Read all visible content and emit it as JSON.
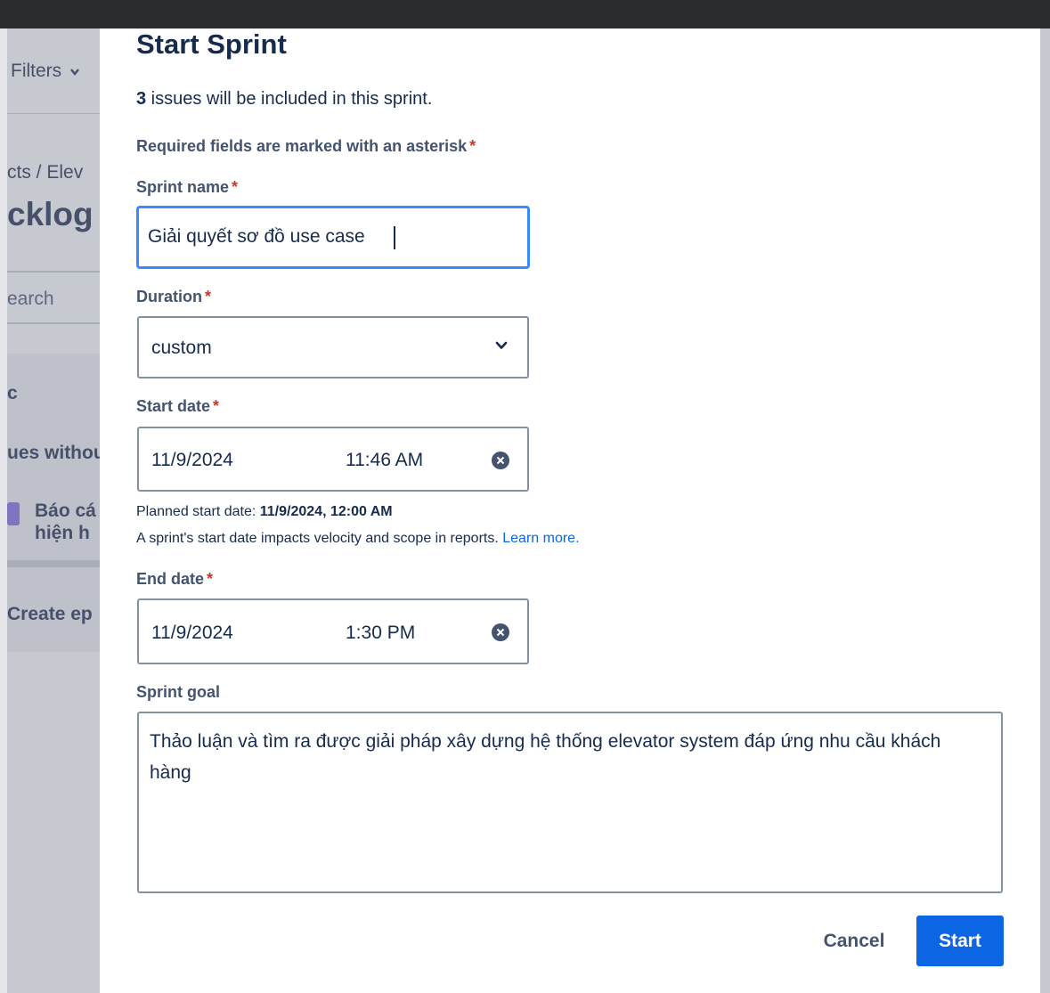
{
  "background": {
    "filters": "Filters",
    "breadcrumb": "cts  /  Elev",
    "page_title": "cklog",
    "search": "earch",
    "epic_header": "c",
    "issues_without": "ues withou",
    "epic_item_line1": "Báo cá",
    "epic_item_line2": "hiện h",
    "create_epic": "Create ep"
  },
  "modal": {
    "title": "Start Sprint",
    "issue_count": "3",
    "issue_text": " issues will be included in this sprint.",
    "required_note": "Required fields are marked with an asterisk",
    "asterisk": "*",
    "sprint_name": {
      "label": "Sprint name",
      "value": "Giải quyết sơ đồ use case"
    },
    "duration": {
      "label": "Duration",
      "value": "custom"
    },
    "start_date": {
      "label": "Start date",
      "date": "11/9/2024",
      "time": "11:46 AM",
      "planned_prefix": "Planned start date: ",
      "planned_value": "11/9/2024, 12:00 AM",
      "impact_text": "A sprint's start date impacts velocity and scope in reports. ",
      "learn_more": "Learn more."
    },
    "end_date": {
      "label": "End date",
      "date": "11/9/2024",
      "time": "1:30 PM"
    },
    "sprint_goal": {
      "label": "Sprint goal",
      "value": "Thảo luận và tìm ra được giải pháp xây dựng hệ thống elevator system đáp ứng nhu cầu khách hàng"
    },
    "cancel_label": "Cancel",
    "start_label": "Start"
  },
  "colors": {
    "primary": "#0c66e4",
    "required": "#c9372c",
    "focus": "#388bff",
    "text": "#172b4d"
  },
  "icons": [
    "chevron-down-icon",
    "clear-icon"
  ]
}
